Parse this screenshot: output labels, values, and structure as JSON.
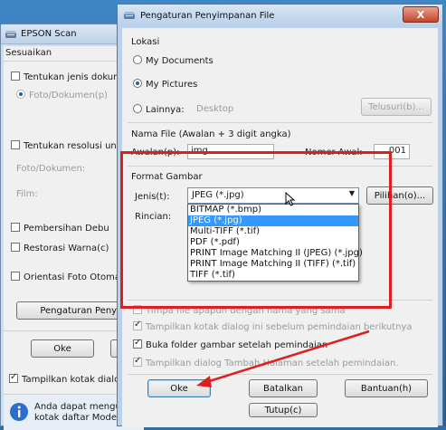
{
  "back_window": {
    "title": "EPSON Scan",
    "group_title": "Sesuaikan",
    "items": {
      "doc_type": "Tentukan jenis dokumen",
      "photo_doc": "Foto/Dokumen(p)",
      "resolution": "Tentukan resolusi untuk",
      "photo_doc_label": "Foto/Dokumen:",
      "film_label": "Film:",
      "dust_removal": "Pembersihan Debu",
      "color_restore": "Restorasi Warna(c)",
      "auto_orient": "Orientasi Foto Otomatis",
      "settings_button": "Pengaturan Penyim",
      "ok_button": "Oke",
      "show_dialog": "Tampilkan kotak dialog ini s",
      "info_text_1": "Anda dapat mengubah",
      "info_text_2": "kotak daftar Mode di k"
    }
  },
  "dialog": {
    "title": "Pengaturan Penyimpanan File",
    "close_label": "X",
    "location": {
      "label": "Lokasi",
      "my_documents": "My Documents",
      "my_pictures": "My Pictures",
      "other_label": "Lainnya:",
      "other_value": "Desktop",
      "browse_button": "Telusuri(b)..."
    },
    "file_name": {
      "label": "Nama File (Awalan + 3 digit angka)",
      "prefix_label": "Awalan(p):",
      "prefix_value": "img",
      "start_label": "Nomer Awal:",
      "start_value": "001"
    },
    "format": {
      "label": "Format Gambar",
      "type_label": "Jenis(t):",
      "selected": "JPEG (*.jpg)",
      "options_button": "Pilihan(o)...",
      "details_label": "Rincian:",
      "dropdown_options": [
        "BITMAP (*.bmp)",
        "JPEG (*.jpg)",
        "Multi-TIFF (*.tif)",
        "PDF (*.pdf)",
        "PRINT Image Matching II (JPEG) (*.jpg)",
        "PRINT Image Matching II (TIFF) (*.tif)",
        "TIFF (*.tif)"
      ],
      "selected_index": 1
    },
    "checks": {
      "overwrite": "Timpa file apapun dengan nama yang sama",
      "show_before_scan": "Tampilkan kotak dialog ini sebelum pemindaian berikutnya",
      "open_folder": "Buka folder gambar setelah pemindaian",
      "show_add_page": "Tampilkan dialog Tambah Halaman setelah pemindaian."
    },
    "buttons": {
      "ok": "Oke",
      "cancel": "Batalkan",
      "help": "Bantuan(h)",
      "behind": "Tutup(c)"
    }
  },
  "annotation_color": "#e01e1e"
}
